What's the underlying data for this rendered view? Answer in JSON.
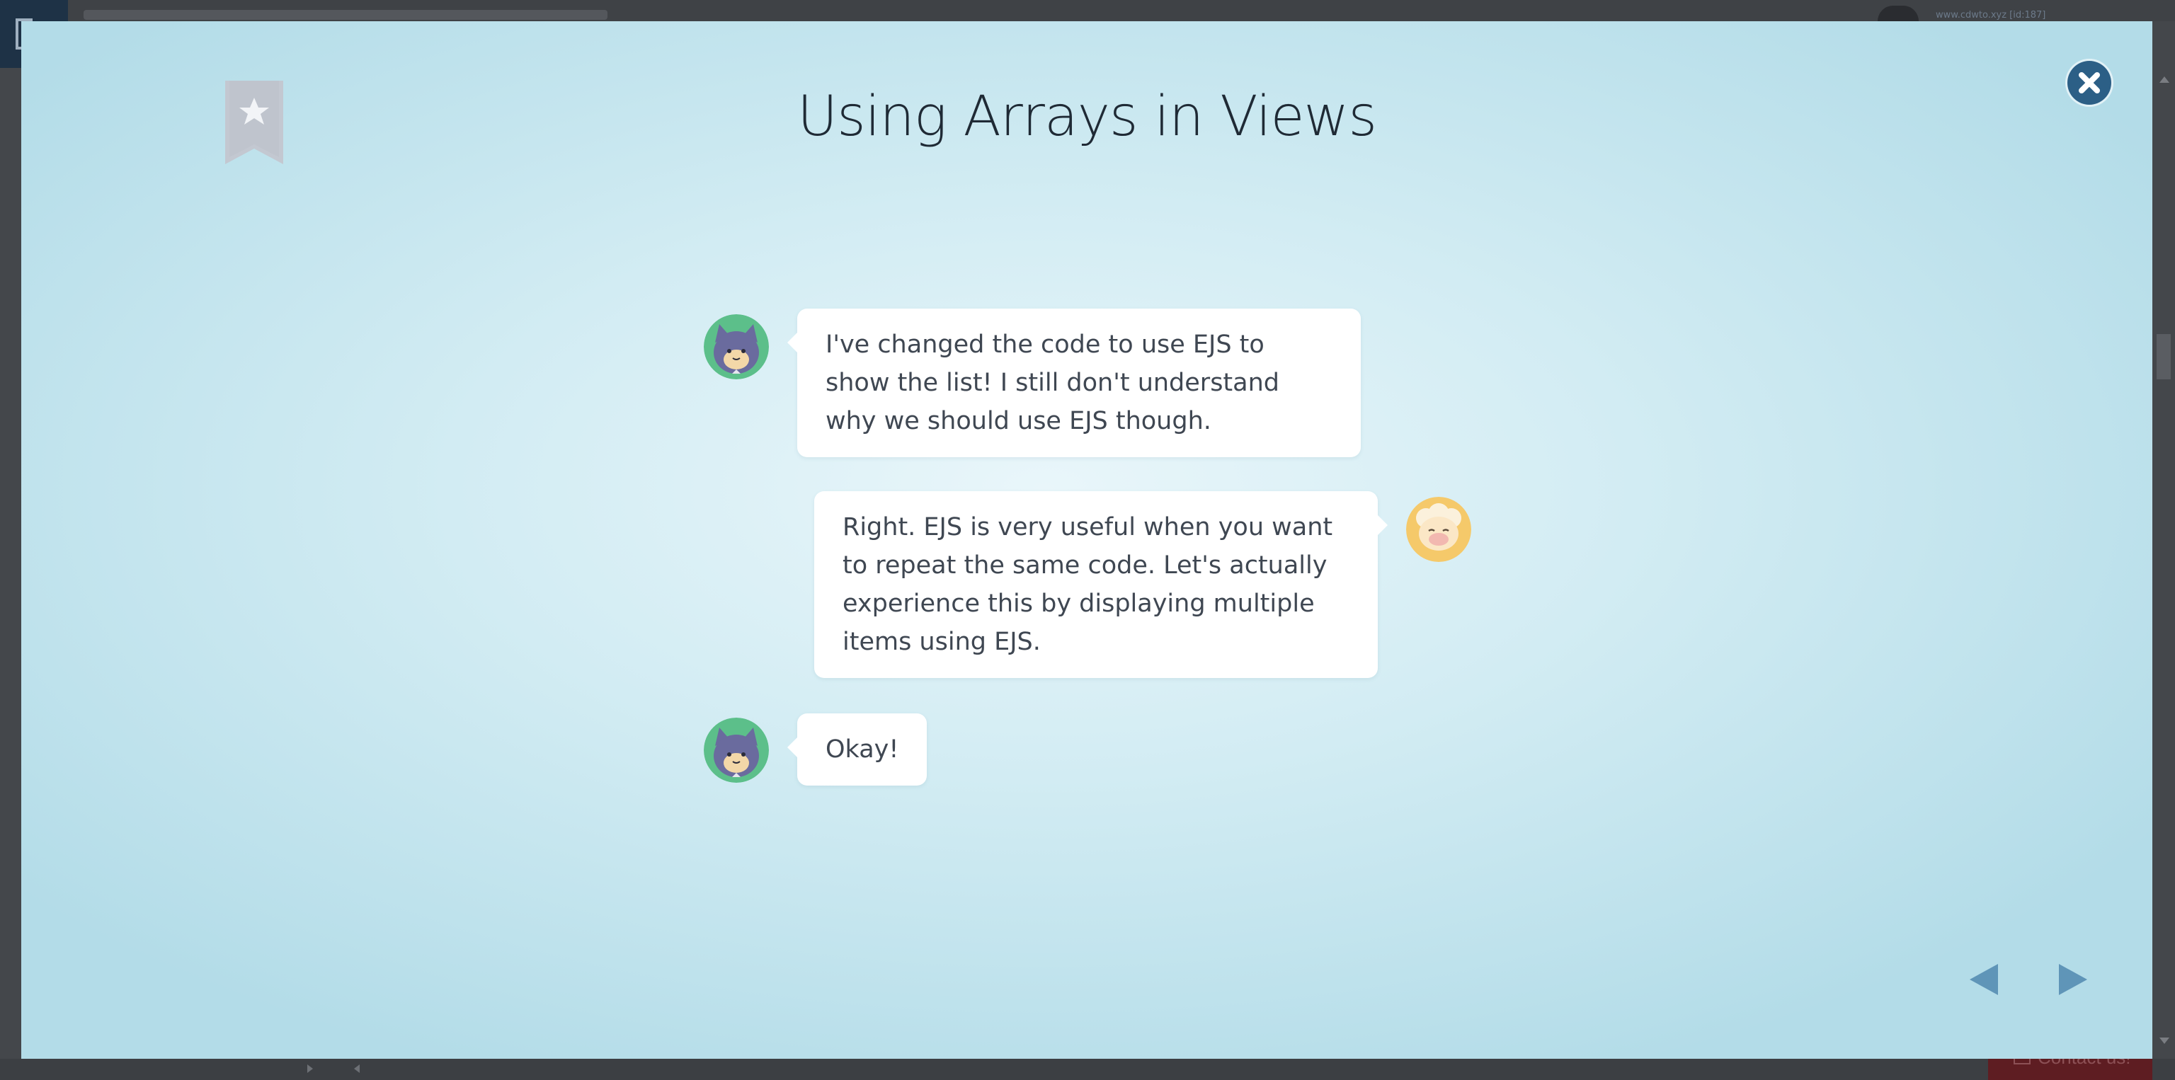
{
  "background_app": {
    "user_label": "www.cdwto.xyz [id:187]",
    "contact_label": "Contact us!"
  },
  "modal": {
    "title": "Using Arrays in Views",
    "bookmark_icon": "bookmark-star-icon",
    "close_icon": "close-icon",
    "messages": [
      {
        "speaker": "student-cat",
        "side": "left",
        "text": "I've changed the code to use EJS to show the list! I still don't understand why we should use EJS though."
      },
      {
        "speaker": "teacher-sheep",
        "side": "right",
        "text": "Right. EJS is very useful when you want to repeat the same code. Let's actually experience this by displaying multiple items using EJS."
      },
      {
        "speaker": "student-cat",
        "side": "left",
        "text": "Okay!"
      }
    ],
    "nav": {
      "prev_icon": "previous-arrow-icon",
      "next_icon": "next-arrow-icon"
    },
    "colors": {
      "close_button": "#2c5f86",
      "nav_arrow": "#5f95b8",
      "bookmark": "#c3c8d1",
      "cat_avatar_bg": "#5cbf8a",
      "sheep_avatar_bg": "#f5c96a"
    }
  }
}
